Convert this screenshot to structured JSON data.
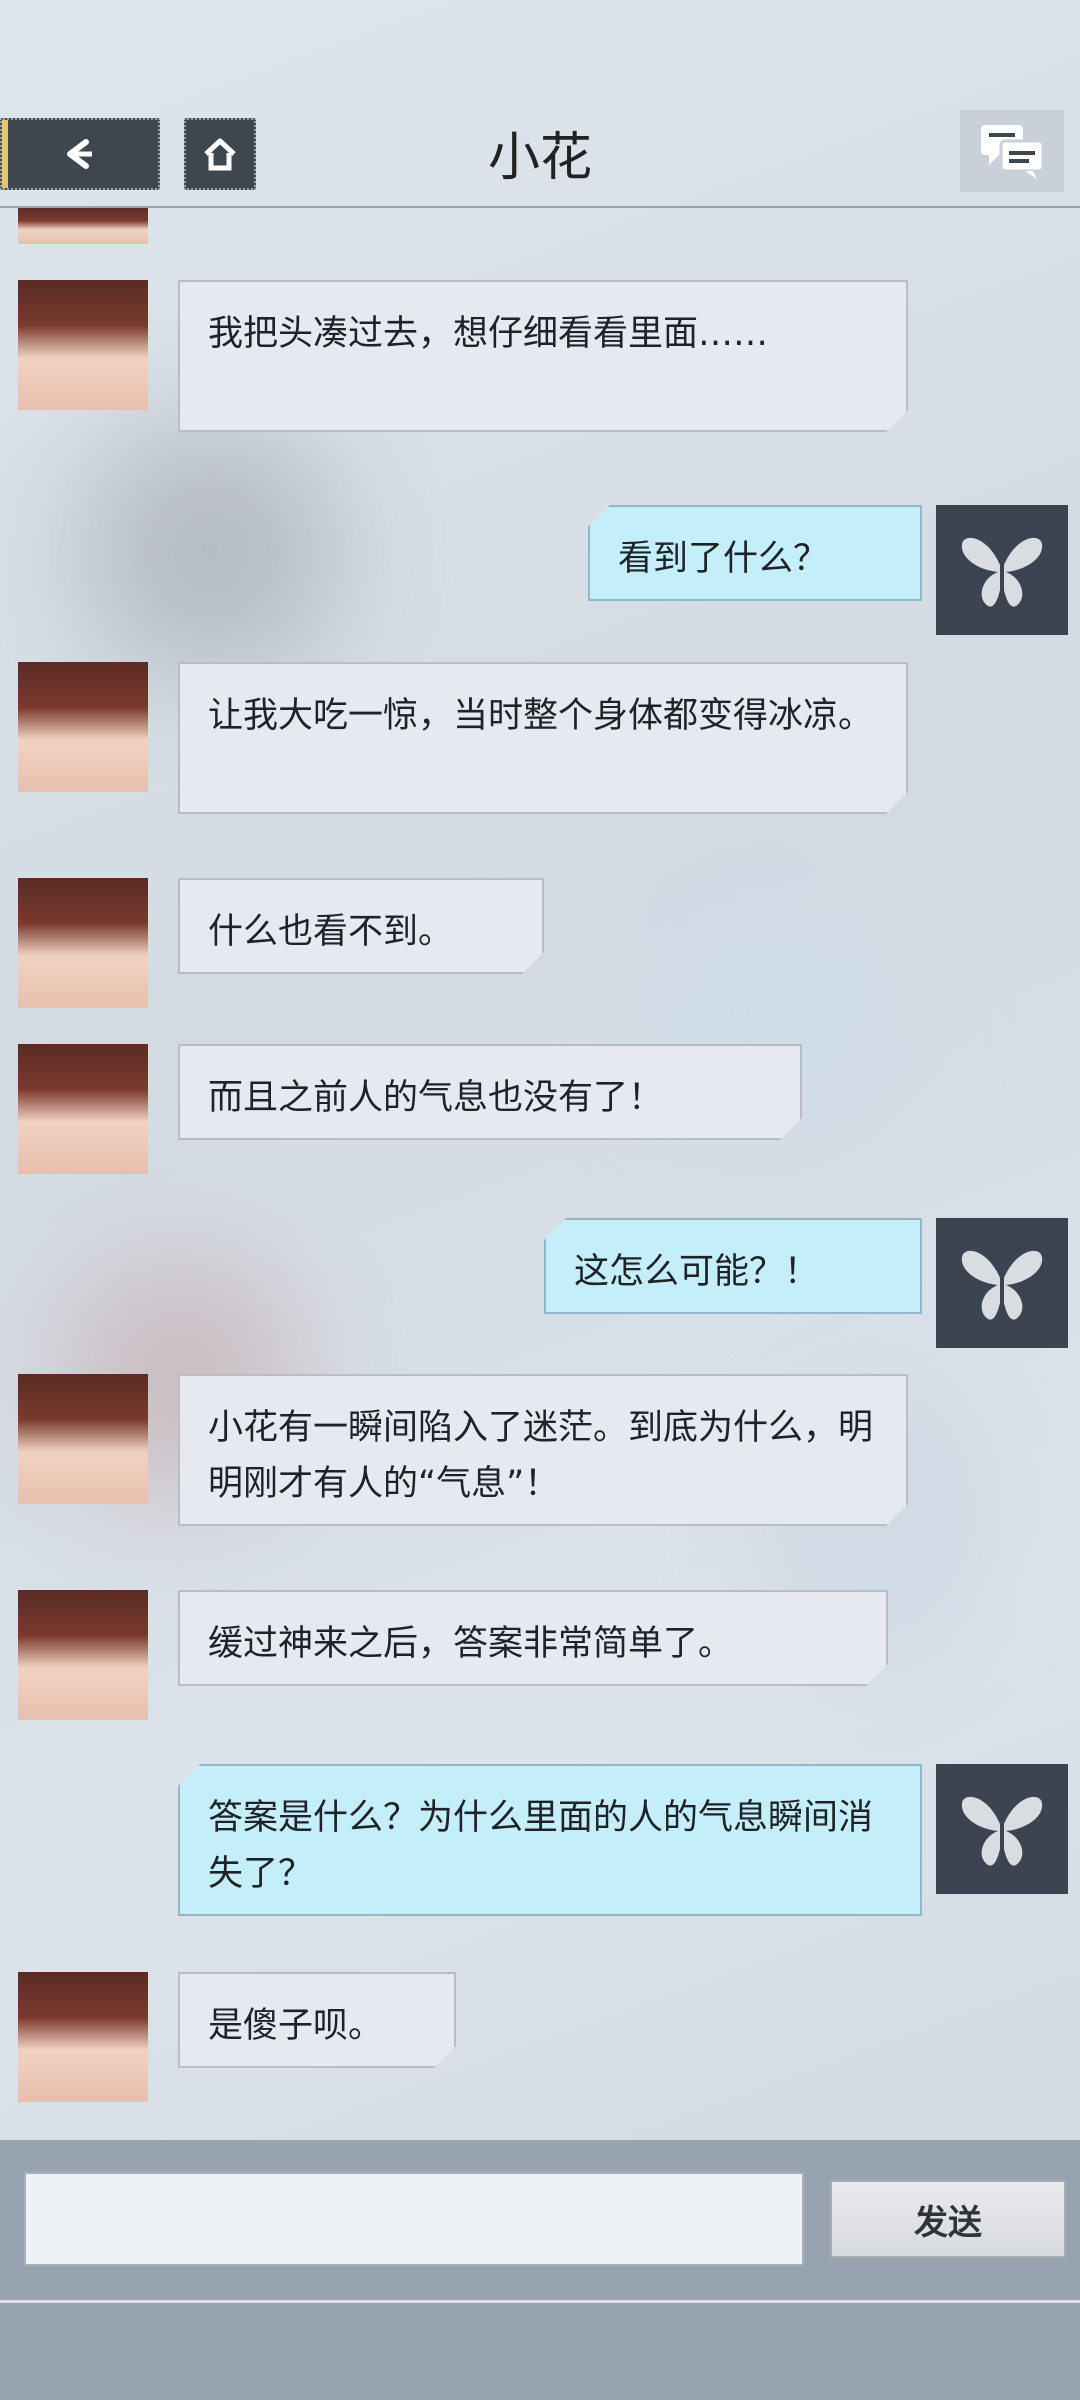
{
  "header": {
    "title": "小花"
  },
  "messages": [
    {
      "sender": "them",
      "text": "我把头凑过去，想仔细看看里面……"
    },
    {
      "sender": "me",
      "text": "看到了什么？"
    },
    {
      "sender": "them",
      "text": "让我大吃一惊，当时整个身体都变得冰凉。"
    },
    {
      "sender": "them",
      "text": "什么也看不到。"
    },
    {
      "sender": "them",
      "text": "而且之前人的气息也没有了！"
    },
    {
      "sender": "me",
      "text": "这怎么可能？！"
    },
    {
      "sender": "them",
      "text": "小花有一瞬间陷入了迷茫。到底为什么，明明刚才有人的“气息”！"
    },
    {
      "sender": "them",
      "text": "缓过神来之后，答案非常简单了。"
    },
    {
      "sender": "me",
      "text": "答案是什么？为什么里面的人的气息瞬间消失了？"
    },
    {
      "sender": "them",
      "text": "是傻子呗。"
    }
  ],
  "composer": {
    "input_value": "",
    "send_label": "发送"
  },
  "colors": {
    "bubble_them": "#e6eaf0",
    "bubble_me": "#c4eefa",
    "accent": "#e9c46a",
    "button_dark": "#3e4650"
  },
  "icons": {
    "back": "back-arrow-icon",
    "home": "home-icon",
    "chat": "chat-bubbles-icon",
    "me_avatar": "butterfly-icon"
  }
}
